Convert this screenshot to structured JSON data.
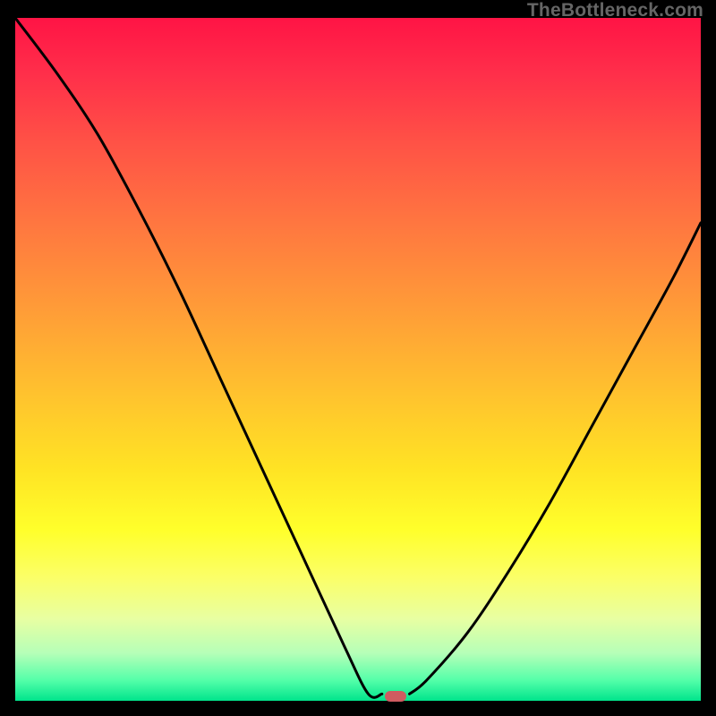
{
  "watermark": "TheBottleneck.com",
  "colors": {
    "frame": "#000000",
    "curve": "#000000",
    "marker": "#cf5b60",
    "gradient_top": "#ff1445",
    "gradient_bottom": "#00e48c"
  },
  "chart_data": {
    "type": "line",
    "title": "",
    "xlabel": "",
    "ylabel": "",
    "xlim": [
      0,
      100
    ],
    "ylim": [
      0,
      100
    ],
    "series": [
      {
        "name": "left-curve",
        "x": [
          0,
          6,
          12,
          18,
          24,
          30,
          36,
          42,
          48,
          51.5,
          53.5
        ],
        "values": [
          100,
          92,
          83,
          72,
          60,
          47,
          34,
          21,
          8,
          1,
          1
        ]
      },
      {
        "name": "right-curve",
        "x": [
          57.5,
          60,
          66,
          72,
          78,
          84,
          90,
          96,
          100
        ],
        "values": [
          1,
          3,
          10,
          19,
          29,
          40,
          51,
          62,
          70
        ]
      }
    ],
    "marker": {
      "x": 55.5,
      "y": 0.6
    },
    "grid": false,
    "legend": false
  }
}
